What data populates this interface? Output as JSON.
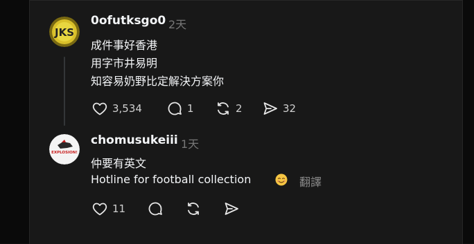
{
  "posts": [
    {
      "username": "0ofutksgo0",
      "time": "2天",
      "lines": [
        "成件事好香港",
        "用字市井易明",
        "知容易奶野比定解決方案你"
      ],
      "actions": {
        "likes": "3,534",
        "replies": "1",
        "reposts": "2",
        "shares": "32"
      }
    },
    {
      "username": "chomusukeiii",
      "time": "1天",
      "lines": [
        "仲要有英文",
        "Hotline for football collection"
      ],
      "translate_label": "翻譯",
      "avatar_text": "EXPLOSION!",
      "actions": {
        "likes": "11"
      }
    }
  ],
  "icons": {
    "heart": "heart-icon",
    "reply": "comment-icon",
    "repost": "repost-icon",
    "share": "send-icon",
    "emoji": "smiling-face-emoji"
  },
  "colors": {
    "background": "#101010",
    "panel": "#181818",
    "text": "#f3f5f7",
    "muted": "#777777"
  }
}
